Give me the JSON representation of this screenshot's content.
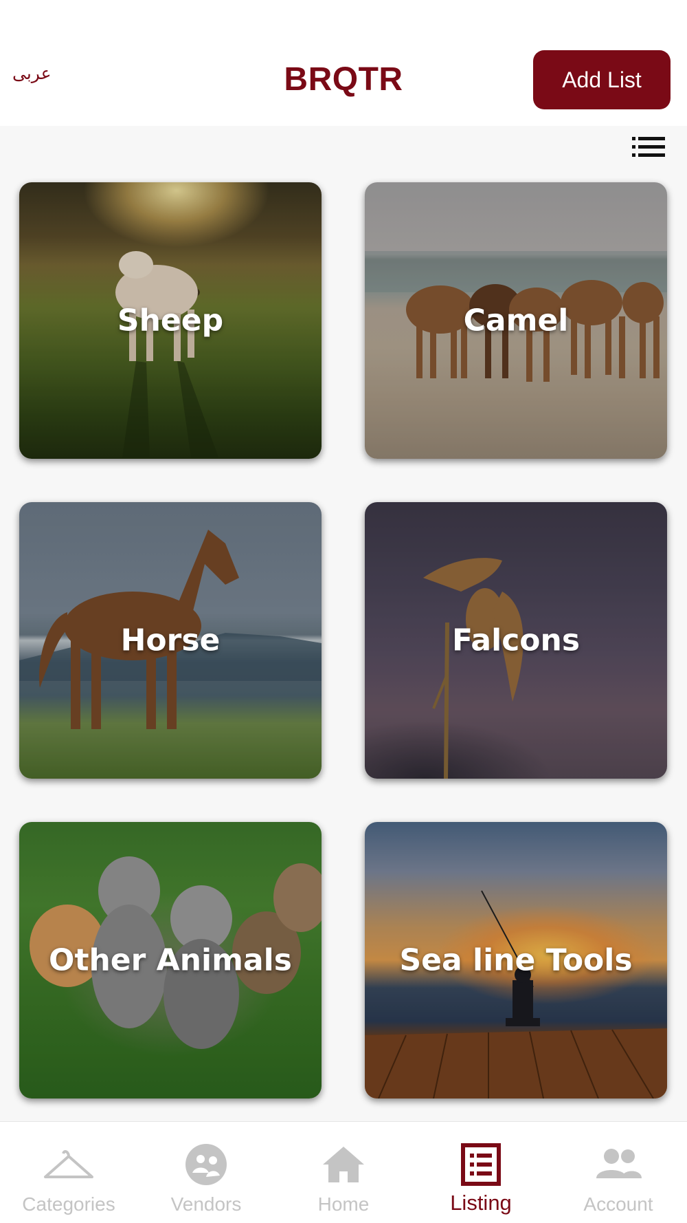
{
  "header": {
    "language_toggle": "عربى",
    "brand": "BRQTR",
    "add_list_label": "Add List"
  },
  "view_toggle_icon": "list-view-icon",
  "categories": [
    {
      "label": "Sheep",
      "image": "sheep-in-sunlit-field"
    },
    {
      "label": "Camel",
      "image": "camels-in-desert"
    },
    {
      "label": "Horse",
      "image": "horse-on-mountain-meadow"
    },
    {
      "label": "Falcons",
      "image": "falcon-landing-on-branch"
    },
    {
      "label": "Other Animals",
      "image": "kittens-on-grass"
    },
    {
      "label": "Sea line Tools",
      "image": "fisherman-at-sunset-pier"
    }
  ],
  "bottom_nav": {
    "items": [
      {
        "label": "Categories",
        "icon": "hanger-icon",
        "active": false
      },
      {
        "label": "Vendors",
        "icon": "vendors-icon",
        "active": false
      },
      {
        "label": "Home",
        "icon": "home-icon",
        "active": false
      },
      {
        "label": "Listing",
        "icon": "listing-icon",
        "active": true
      },
      {
        "label": "Account",
        "icon": "account-icon",
        "active": false
      }
    ]
  },
  "colors": {
    "brand": "#7a0a16",
    "inactive_nav": "#c4c4c4",
    "background": "#f7f7f7"
  }
}
